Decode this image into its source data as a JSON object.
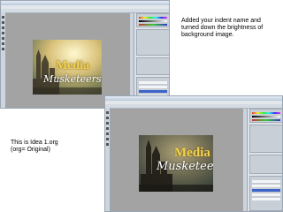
{
  "annotations": {
    "top_note": [
      "Added your indent name and",
      "turned down the brightness of",
      "background image."
    ],
    "bottom_note": [
      "This is Idea 1.org",
      "(org= Original)"
    ]
  },
  "screenshot_original": {
    "image_title": "Media",
    "image_subtitle": "Musketeers"
  },
  "screenshot_edited": {
    "image_title": "Media",
    "image_subtitle": "Musketeers"
  },
  "colors": {
    "title_gold": "#f2d44c",
    "layer_selected": "#3c64c8",
    "canvas_gray": "#a3a3a3"
  }
}
